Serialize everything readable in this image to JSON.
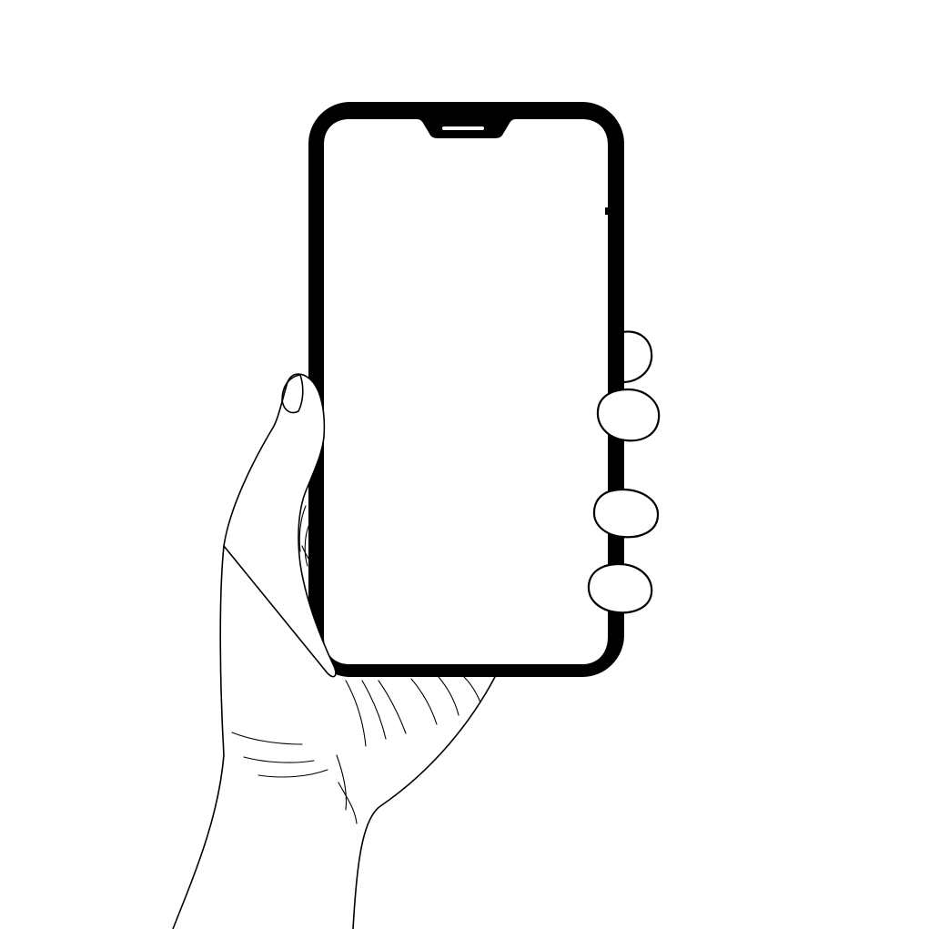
{
  "illustration": {
    "subject": "hand-holding-phone",
    "style": "line-art",
    "colors": {
      "background": "#ffffff",
      "ink": "#000000",
      "screen": "#ffffff"
    },
    "phone": {
      "screen_state": "blank"
    }
  }
}
